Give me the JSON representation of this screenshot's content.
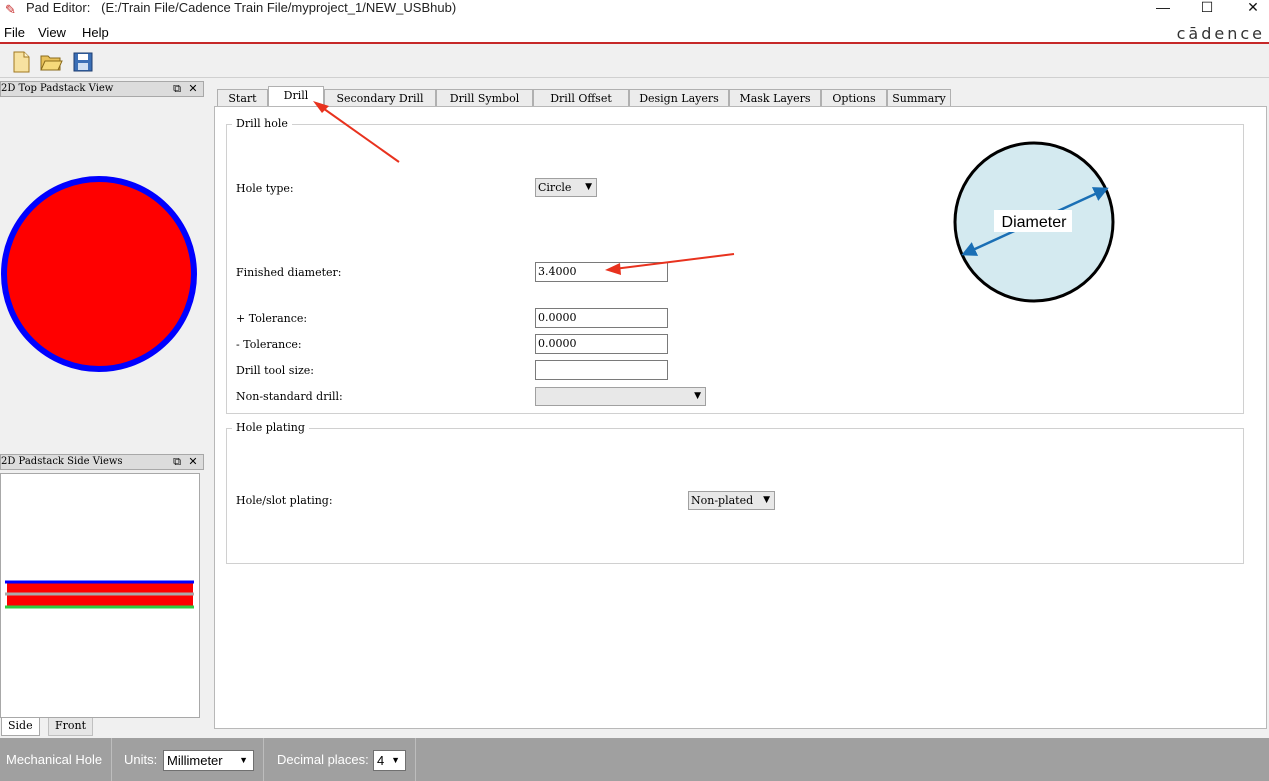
{
  "window": {
    "app": "Pad Editor:",
    "path": "(E:/Train File/Cadence Train File/myproject_1/NEW_USBhub)",
    "brand": "cādence"
  },
  "menu": {
    "file": "File",
    "view": "View",
    "help": "Help"
  },
  "toolbar": {
    "icons": [
      "new-file-icon",
      "open-folder-icon",
      "save-icon"
    ]
  },
  "panels": {
    "top_view_title": "2D Top Padstack View",
    "side_view_title": "2D Padstack Side Views",
    "side_tabs": [
      "Side",
      "Front"
    ]
  },
  "tabs": [
    "Start",
    "Drill",
    "Secondary Drill",
    "Drill Symbol",
    "Drill Offset",
    "Design Layers",
    "Mask Layers",
    "Options",
    "Summary"
  ],
  "active_tab": "Drill",
  "drill_hole": {
    "title": "Drill hole",
    "hole_type_label": "Hole type:",
    "hole_type_value": "Circle",
    "finished_diameter_label": "Finished diameter:",
    "finished_diameter_value": "3.4000",
    "plus_tol_label": "+ Tolerance:",
    "plus_tol_value": "0.0000",
    "minus_tol_label": "- Tolerance:",
    "minus_tol_value": "0.0000",
    "tool_size_label": "Drill tool size:",
    "tool_size_value": "",
    "nonstd_label": "Non-standard drill:",
    "nonstd_value": "",
    "diagram_label": "Diameter"
  },
  "hole_plating": {
    "title": "Hole plating",
    "plating_label": "Hole/slot plating:",
    "plating_value": "Non-plated"
  },
  "status": {
    "mode": "Mechanical Hole",
    "units_label": "Units:",
    "units_value": "Millimeter",
    "decimal_label": "Decimal places:",
    "decimal_value": "4"
  },
  "colors": {
    "pad_fill": "#ff0000",
    "pad_ring": "#0000ff",
    "annotation_arrow": "#e8321e",
    "diagram_fill": "#d4eaf0",
    "diagram_arrow": "#1a6fb5"
  }
}
